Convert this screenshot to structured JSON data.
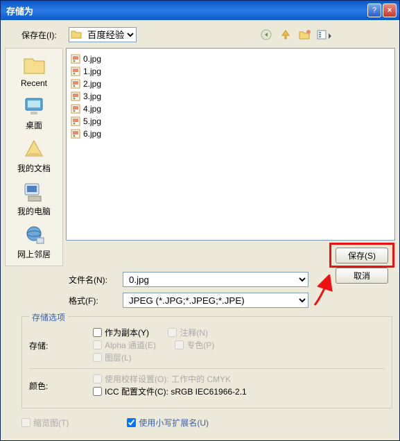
{
  "dialog_title": "存储为",
  "savein": {
    "label": "保存在(I):",
    "value": "百度经验"
  },
  "sidebar": {
    "items": [
      {
        "label": "Recent"
      },
      {
        "label": "桌面"
      },
      {
        "label": "我的文档"
      },
      {
        "label": "我的电脑"
      },
      {
        "label": "网上邻居"
      }
    ]
  },
  "files": [
    "0.jpg",
    "1.jpg",
    "2.jpg",
    "3.jpg",
    "4.jpg",
    "5.jpg",
    "6.jpg"
  ],
  "filename": {
    "label": "文件名(N):",
    "value": "0.jpg"
  },
  "format": {
    "label": "格式(F):",
    "value": "JPEG (*.JPG;*.JPEG;*.JPE)"
  },
  "buttons": {
    "save": "保存(S)",
    "cancel": "取消"
  },
  "options": {
    "legend": "存储选项",
    "save_label": "存储:",
    "as_copy": "作为副本(Y)",
    "annotations": "注释(N)",
    "alpha": "Alpha 通道(E)",
    "spot": "专色(P)",
    "layers": "图层(L)",
    "color_label": "颜色:",
    "proof_setup": "使用校样设置(O): 工作中的 CMYK",
    "icc": "ICC 配置文件(C): sRGB IEC61966-2.1"
  },
  "bottom": {
    "thumbnail": "缩览图(T)",
    "lowercase_ext": "使用小写扩展名(U)",
    "lowercase_checked": true
  }
}
